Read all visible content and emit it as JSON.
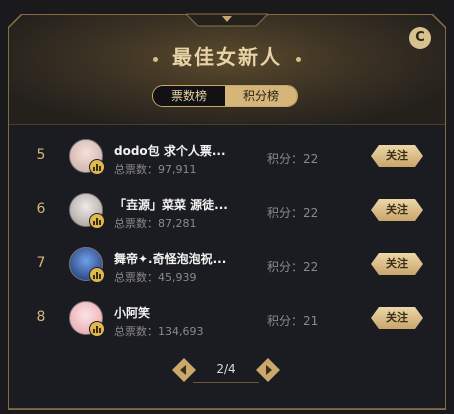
{
  "title": "最佳女新人",
  "tabs": [
    {
      "label": "票数榜",
      "active": false
    },
    {
      "label": "积分榜",
      "active": true
    }
  ],
  "rows": [
    {
      "rank": "5",
      "name": "dodo包 求个人票...",
      "votes": "总票数：97,911",
      "score": "积分：22",
      "follow": "关注",
      "avatar_color": "#e8c9c3"
    },
    {
      "rank": "6",
      "name": "「壵源」菜菜 源徒...",
      "votes": "总票数：87,281",
      "score": "积分：22",
      "follow": "关注",
      "avatar_color": "#d9d0cc"
    },
    {
      "rank": "7",
      "name": "舞帝✦.奇怪泡泡祝...",
      "votes": "总票数：45,939",
      "score": "积分：22",
      "follow": "关注",
      "avatar_color": "#2a4a8a"
    },
    {
      "rank": "8",
      "name": "小阿笑",
      "votes": "总票数：134,693",
      "score": "积分：21",
      "follow": "关注",
      "avatar_color": "#f0c4c4"
    }
  ],
  "pager": {
    "text": "2/4"
  },
  "colors": {
    "accent": "#d6b57a",
    "background": "#1b1c21"
  }
}
